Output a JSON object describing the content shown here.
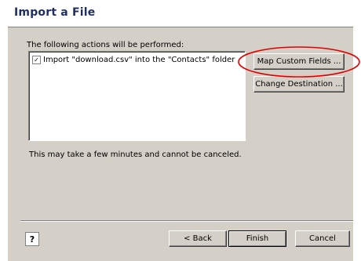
{
  "dialog": {
    "title": "Import a File",
    "description": "The following actions will be performed:",
    "list_items": [
      {
        "checked": true,
        "label": "Import \"download.csv\" into the \"Contacts\" folder"
      }
    ],
    "buttons": {
      "map_custom_fields": "Map Custom Fields ...",
      "change_destination": "Change Destination ..."
    },
    "note": "This may take a few minutes and cannot be canceled.",
    "footer": {
      "help_label": "?",
      "back": "< Back",
      "finish": "Finish",
      "cancel": "Cancel"
    }
  },
  "annotation": {
    "highlight_color": "#e00000"
  }
}
